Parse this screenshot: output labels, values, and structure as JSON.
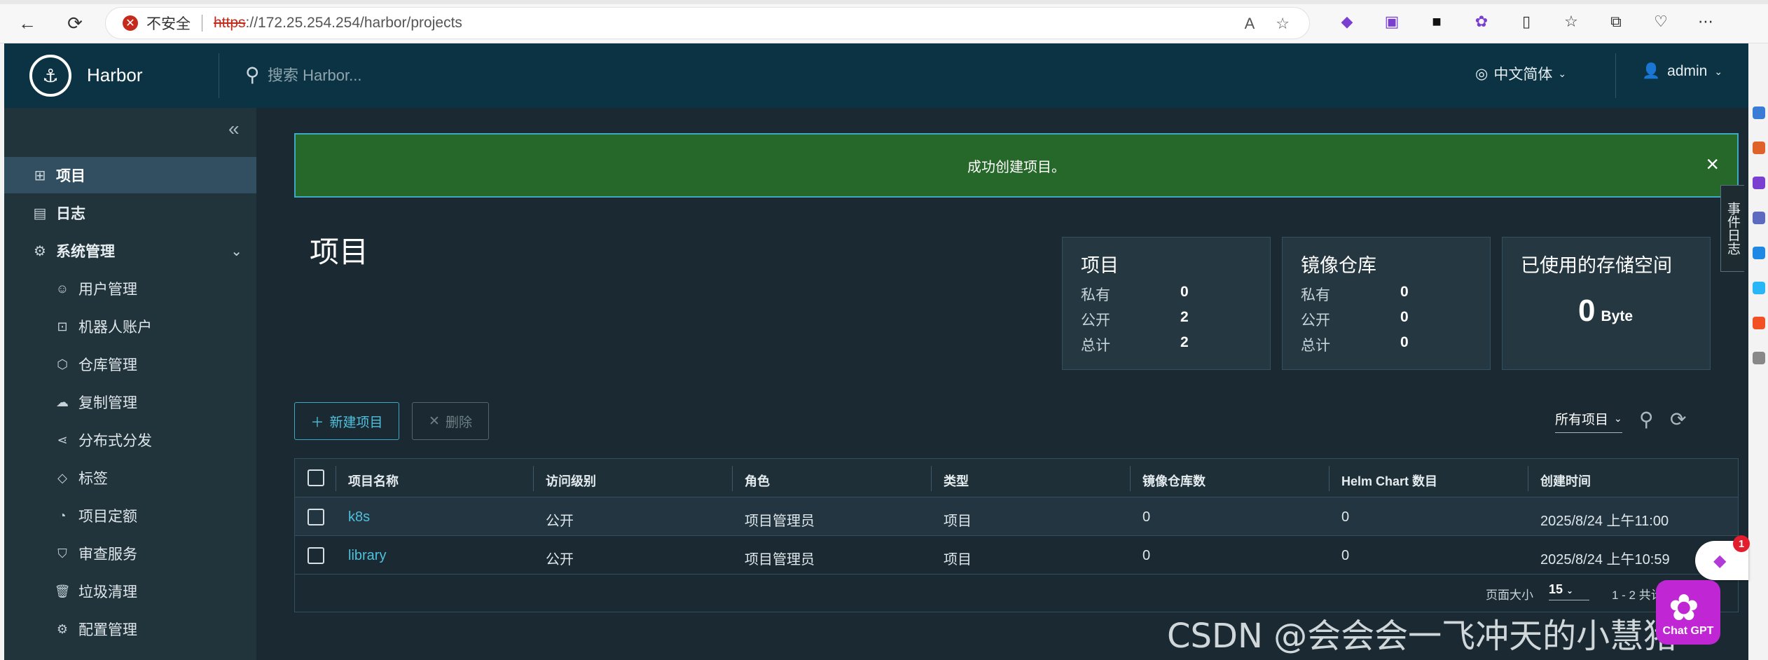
{
  "browser": {
    "insecure_label": "不安全",
    "url_proto": "https",
    "url_rest": "://172.25.254.254/harbor/projects"
  },
  "header": {
    "brand": "Harbor",
    "search_placeholder": "搜索 Harbor...",
    "language": "中文简体",
    "user": "admin"
  },
  "sidebar": {
    "items": [
      {
        "label": "项目",
        "icon": "projects-icon"
      },
      {
        "label": "日志",
        "icon": "logs-icon"
      },
      {
        "label": "系统管理",
        "icon": "admin-icon"
      }
    ],
    "sub_items": [
      {
        "label": "用户管理",
        "icon": "users-icon"
      },
      {
        "label": "机器人账户",
        "icon": "robot-icon"
      },
      {
        "label": "仓库管理",
        "icon": "registry-icon"
      },
      {
        "label": "复制管理",
        "icon": "replication-icon"
      },
      {
        "label": "分布式分发",
        "icon": "distribution-icon"
      },
      {
        "label": "标签",
        "icon": "tag-icon"
      },
      {
        "label": "项目定额",
        "icon": "quota-icon"
      },
      {
        "label": "审查服务",
        "icon": "shield-icon"
      },
      {
        "label": "垃圾清理",
        "icon": "trash-icon"
      },
      {
        "label": "配置管理",
        "icon": "gear-icon"
      }
    ]
  },
  "alert": {
    "message": "成功创建项目。"
  },
  "event_log_tab": "事件日志",
  "page": {
    "title": "项目"
  },
  "cards": {
    "projects": {
      "title": "项目",
      "private_label": "私有",
      "private": "0",
      "public_label": "公开",
      "public": "2",
      "total_label": "总计",
      "total": "2"
    },
    "repos": {
      "title": "镜像仓库",
      "private_label": "私有",
      "private": "0",
      "public_label": "公开",
      "public": "0",
      "total_label": "总计",
      "total": "0"
    },
    "storage": {
      "title": "已使用的存储空间",
      "value": "0",
      "unit": "Byte"
    }
  },
  "toolbar": {
    "new_project": "新建项目",
    "delete": "删除",
    "filter": "所有项目"
  },
  "table": {
    "headers": [
      "项目名称",
      "访问级别",
      "角色",
      "类型",
      "镜像仓库数",
      "Helm Chart 数目",
      "创建时间"
    ],
    "rows": [
      [
        "k8s",
        "公开",
        "项目管理员",
        "项目",
        "0",
        "0",
        "2025/8/24 上午11:00"
      ],
      [
        "library",
        "公开",
        "项目管理员",
        "项目",
        "0",
        "0",
        "2025/8/24 上午10:59"
      ]
    ],
    "page_size_label": "页面大小",
    "page_size": "15",
    "total_text": "1 - 2 共计"
  },
  "overlay": {
    "watermark": "CSDN @会会会一飞冲天的小慧猪~",
    "chat_label": "Chat GPT",
    "notification_count": "1"
  }
}
